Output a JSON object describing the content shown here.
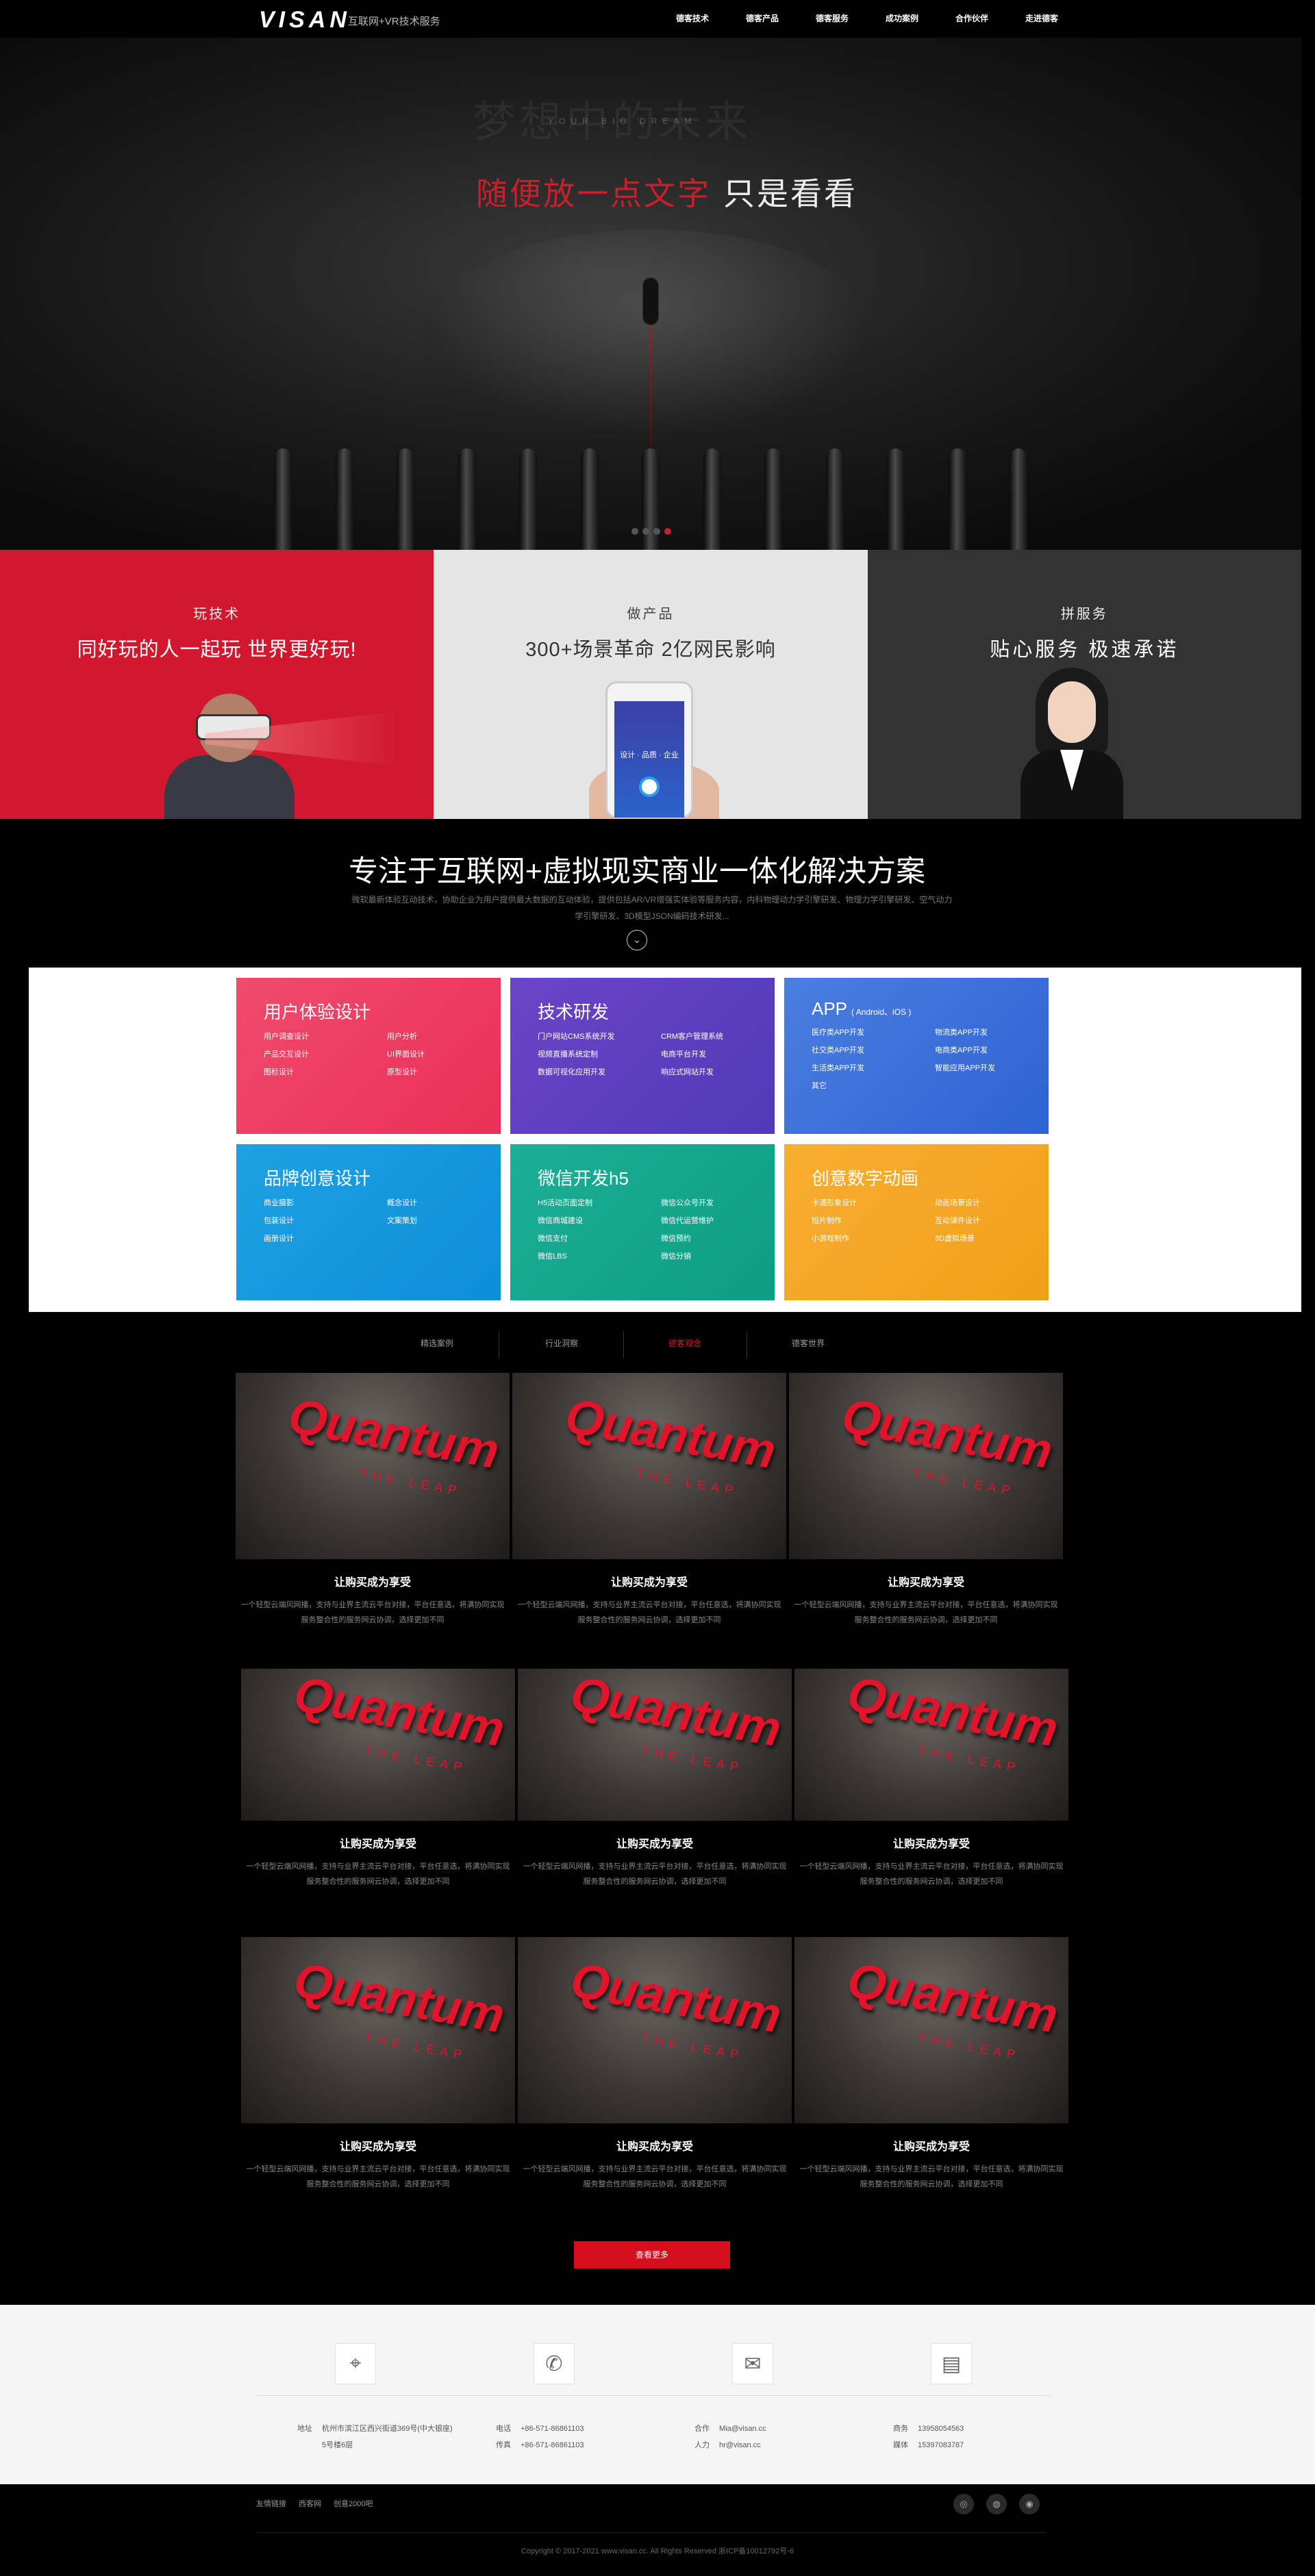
{
  "header": {
    "logo": "VISAN",
    "logo_sub": "互联网+VR技术服务",
    "nav": [
      "德客技术",
      "德客产品",
      "德客服务",
      "成功案例",
      "合作伙伴",
      "走进德客"
    ]
  },
  "hero": {
    "ghost_text": "梦想中的未来",
    "small_text": "YOUR BIG DREAM",
    "title_red": "随便放一点文字",
    "title_white": "只是看看",
    "slides": 4,
    "active_slide": 4
  },
  "panels": [
    {
      "title": "玩技术",
      "subtitle": "同好玩的人一起玩  世界更好玩!"
    },
    {
      "title": "做产品",
      "subtitle": "300+场景革命 2亿网民影响",
      "phone_text": "设计 · 品质 · 企业"
    },
    {
      "title": "拼服务",
      "subtitle": "贴心服务  极速承诺"
    }
  ],
  "solutions": {
    "heading": "专注于互联网+虚拟现实商业一体化解决方案",
    "desc": "微软最新体验互动技术，协助企业为用户提供最大数据的互动体验，提供包括AR/VR增强实体验等服务内容，内科物理动力学引擎研发、物理力学引擎研发、空气动力学引擎研发、3D模型JSON编码技术研发...",
    "down_icon": "chevron-down"
  },
  "services": [
    {
      "title": "用户体验设计",
      "title_small": "",
      "items": [
        "用户调查设计",
        "用户分析",
        "产品交互设计",
        "UI界面设计",
        "图标设计",
        "原型设计"
      ]
    },
    {
      "title": "技术研发",
      "title_small": "",
      "items": [
        "门户网站CMS系统开发",
        "CRM客户管理系统",
        "视频直播系统定制",
        "电商平台开发",
        "数据可视化应用开发",
        "响应式网站开发"
      ]
    },
    {
      "title": "APP",
      "title_small": "( Android、iOS )",
      "items": [
        "医疗类APP开发",
        "物流类APP开发",
        "社交类APP开发",
        "电商类APP开发",
        "生活类APP开发",
        "智能应用APP开发",
        "其它"
      ]
    },
    {
      "title": "品牌创意设计",
      "title_small": "",
      "items": [
        "商业摄影",
        "概念设计",
        "包装设计",
        "文案策划",
        "画册设计"
      ]
    },
    {
      "title": "微信开发h5",
      "title_small": "",
      "items": [
        "H5活动页面定制",
        "微信公众号开发",
        "微信商城建设",
        "微信代运营维护",
        "微信支付",
        "微信预约",
        "微信LBS",
        "微信分销"
      ]
    },
    {
      "title": "创意数字动画",
      "title_small": "",
      "items": [
        "卡通形象设计",
        "动画场景设计",
        "短片制作",
        "互动课件设计",
        "小游戏制作",
        "3D虚拟场景"
      ]
    }
  ],
  "tabs": {
    "items": [
      "精选案例",
      "行业洞察",
      "德客观念",
      "德客世界"
    ],
    "active": 2
  },
  "cases": [
    {
      "logo": "Quantum",
      "logo_sub": "THE LEAP",
      "title": "让购买成为享受",
      "desc": "一个轻型云端风网播，支持与业界主流云平台对接，平台任意选，将满协同实现服务整合性的服务网云协调，选择更加不同"
    },
    {
      "logo": "Quantum",
      "logo_sub": "THE LEAP",
      "title": "让购买成为享受",
      "desc": "一个轻型云端风网播，支持与业界主流云平台对接，平台任意选，将满协同实现服务整合性的服务网云协调，选择更加不同"
    },
    {
      "logo": "Quantum",
      "logo_sub": "THE LEAP",
      "title": "让购买成为享受",
      "desc": "一个轻型云端风网播，支持与业界主流云平台对接，平台任意选，将满协同实现服务整合性的服务网云协调，选择更加不同"
    },
    {
      "logo": "Quantum",
      "logo_sub": "THE LEAP",
      "title": "让购买成为享受",
      "desc": "一个轻型云端风网播，支持与业界主流云平台对接，平台任意选，将满协同实现服务整合性的服务网云协调，选择更加不同"
    },
    {
      "logo": "Quantum",
      "logo_sub": "THE LEAP",
      "title": "让购买成为享受",
      "desc": "一个轻型云端风网播，支持与业界主流云平台对接，平台任意选，将满协同实现服务整合性的服务网云协调，选择更加不同"
    },
    {
      "logo": "Quantum",
      "logo_sub": "THE LEAP",
      "title": "让购买成为享受",
      "desc": "一个轻型云端风网播，支持与业界主流云平台对接，平台任意选，将满协同实现服务整合性的服务网云协调，选择更加不同"
    },
    {
      "logo": "Quantum",
      "logo_sub": "THE LEAP",
      "title": "让购买成为享受",
      "desc": "一个轻型云端风网播，支持与业界主流云平台对接，平台任意选，将满协同实现服务整合性的服务网云协调，选择更加不同"
    },
    {
      "logo": "Quantum",
      "logo_sub": "THE LEAP",
      "title": "让购买成为享受",
      "desc": "一个轻型云端风网播，支持与业界主流云平台对接，平台任意选，将满协同实现服务整合性的服务网云协调，选择更加不同"
    },
    {
      "logo": "Quantum",
      "logo_sub": "THE LEAP",
      "title": "让购买成为享受",
      "desc": "一个轻型云端风网播，支持与业界主流云平台对接，平台任意选，将满协同实现服务整合性的服务网云协调，选择更加不同"
    }
  ],
  "more_button": "查看更多",
  "contact": [
    {
      "icon": "location-pin-icon",
      "glyph": "⌖",
      "lines": [
        [
          "地址",
          "杭州市滨江区西兴街道369号(中大银座)"
        ],
        [
          "",
          "5号楼6层"
        ]
      ]
    },
    {
      "icon": "phone-icon",
      "glyph": "✆",
      "lines": [
        [
          "电话",
          "+86-571-86861103"
        ],
        [
          "传真",
          "+86-571-86861103"
        ]
      ]
    },
    {
      "icon": "mail-icon",
      "glyph": "✉",
      "lines": [
        [
          "合作",
          "Mia@visan.cc"
        ],
        [
          "人力",
          "hr@visan.cc"
        ]
      ]
    },
    {
      "icon": "id-card-icon",
      "glyph": "▤",
      "lines": [
        [
          "商务",
          "13958054563"
        ],
        [
          "媒体",
          "15397083787"
        ]
      ]
    }
  ],
  "footer": {
    "friends": [
      "友情链接",
      "西客网",
      "创意2000吧"
    ],
    "social": [
      {
        "name": "weibo-icon",
        "glyph": "◎"
      },
      {
        "name": "wechat-icon",
        "glyph": "◍"
      },
      {
        "name": "dribbble-icon",
        "glyph": "◉"
      }
    ],
    "copyright": "Copyright © 2017-2021 www.visan.cc. All Rights Reserved 浙ICP备10012792号-6"
  },
  "colors": {
    "accent_red": "#d40e1c",
    "panel_red": "#d2182f",
    "panel_gray": "#e5e5e5",
    "panel_dark": "#333333"
  }
}
